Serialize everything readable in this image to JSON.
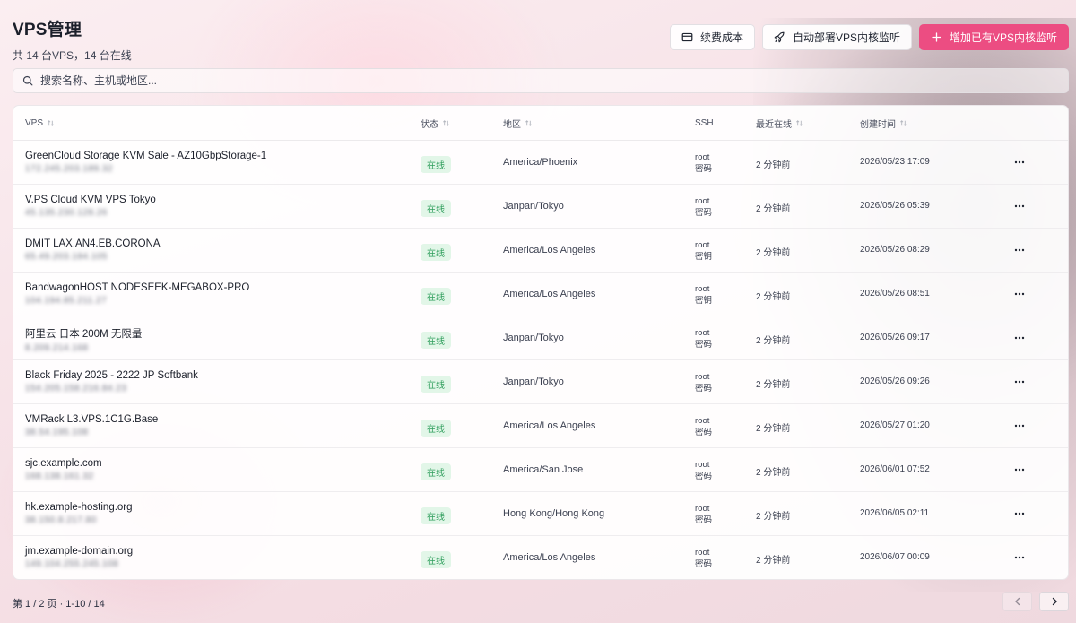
{
  "header": {
    "title": "VPS管理",
    "subtitle": "共 14 台VPS，14 台在线"
  },
  "actions": {
    "renew_cost": "续费成本",
    "auto_deploy": "自动部署VPS内核监听",
    "add_existing": "增加已有VPS内核监听"
  },
  "search": {
    "placeholder": "搜索名称、主机或地区...",
    "value": ""
  },
  "table": {
    "columns": {
      "vps": "VPS",
      "status": "状态",
      "region": "地区",
      "ssh": "SSH",
      "last_seen": "最近在线",
      "created": "创建时间"
    },
    "rows": [
      {
        "name": "GreenCloud Storage KVM Sale - AZ10GbpStorage-1",
        "ip": "172.245.203.189.32",
        "status": "在线",
        "region": "America/Phoenix",
        "ssh_user": "root",
        "ssh_auth": "密码",
        "last_seen": "2 分钟前",
        "created": "2026/05/23 17:09"
      },
      {
        "name": "V.PS Cloud KVM VPS Tokyo",
        "ip": "45.135.230.128.26",
        "status": "在线",
        "region": "Janpan/Tokyo",
        "ssh_user": "root",
        "ssh_auth": "密码",
        "last_seen": "2 分钟前",
        "created": "2026/05/26 05:39"
      },
      {
        "name": "DMIT LAX.AN4.EB.CORONA",
        "ip": "65.49.203.184.105",
        "status": "在线",
        "region": "America/Los Angeles",
        "ssh_user": "root",
        "ssh_auth": "密钥",
        "last_seen": "2 分钟前",
        "created": "2026/05/26 08:29"
      },
      {
        "name": "BandwagonHOST NODESEEK-MEGABOX-PRO",
        "ip": "104.194.85.211.27",
        "status": "在线",
        "region": "America/Los Angeles",
        "ssh_user": "root",
        "ssh_auth": "密钥",
        "last_seen": "2 分钟前",
        "created": "2026/05/26 08:51"
      },
      {
        "name": "阿里云 日本 200M 无限量",
        "ip": "8.209.214.168",
        "status": "在线",
        "region": "Janpan/Tokyo",
        "ssh_user": "root",
        "ssh_auth": "密码",
        "last_seen": "2 分钟前",
        "created": "2026/05/26 09:17"
      },
      {
        "name": "Black Friday 2025 - 2222 JP Softbank",
        "ip": "154.205.158.216.84.23",
        "status": "在线",
        "region": "Janpan/Tokyo",
        "ssh_user": "root",
        "ssh_auth": "密码",
        "last_seen": "2 分钟前",
        "created": "2026/05/26 09:26"
      },
      {
        "name": "VMRack L3.VPS.1C1G.Base",
        "ip": "38.54.195.108",
        "status": "在线",
        "region": "America/Los Angeles",
        "ssh_user": "root",
        "ssh_auth": "密码",
        "last_seen": "2 分钟前",
        "created": "2026/05/27 01:20"
      },
      {
        "name": "sjc.example.com",
        "ip": "168.138.161.32",
        "status": "在线",
        "region": "America/San Jose",
        "ssh_user": "root",
        "ssh_auth": "密码",
        "last_seen": "2 分钟前",
        "created": "2026/06/01 07:52"
      },
      {
        "name": "hk.example-hosting.org",
        "ip": "38.150.8.217.80",
        "status": "在线",
        "region": "Hong Kong/Hong Kong",
        "ssh_user": "root",
        "ssh_auth": "密码",
        "last_seen": "2 分钟前",
        "created": "2026/06/05 02:11"
      },
      {
        "name": "jm.example-domain.org",
        "ip": "149.104.255.245.108",
        "status": "在线",
        "region": "America/Los Angeles",
        "ssh_user": "root",
        "ssh_auth": "密码",
        "last_seen": "2 分钟前",
        "created": "2026/06/07 00:09"
      }
    ]
  },
  "footer": {
    "page_info": "第 1 / 2 页 · 1-10 / 14"
  },
  "colors": {
    "accent": "#ec4d82",
    "online_text": "#2f9e5c",
    "online_bg": "#e2f6e8"
  },
  "icons": {
    "renew": "credit-card-icon",
    "deploy": "rocket-icon",
    "add": "plus-icon",
    "search": "search-icon",
    "sort": "sort-arrows-icon",
    "more": "more-horizontal-icon",
    "prev": "chevron-left-icon",
    "next": "chevron-right-icon"
  }
}
